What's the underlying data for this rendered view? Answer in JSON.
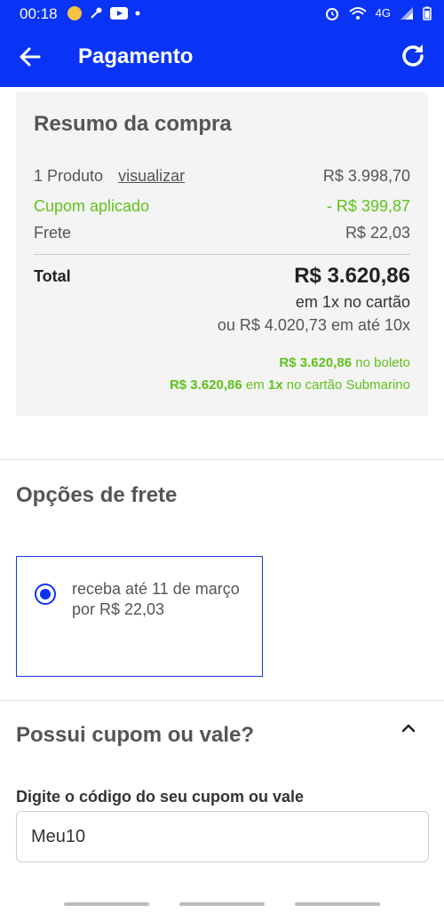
{
  "status": {
    "time": "00:18",
    "network": "4G"
  },
  "appbar": {
    "title": "Pagamento",
    "back_icon": "arrow-left-icon",
    "refresh_icon": "refresh-icon"
  },
  "summary": {
    "heading": "Resumo da compra",
    "product_label": "1 Produto",
    "view_link": "visualizar",
    "product_value": "R$ 3.998,70",
    "coupon_label": "Cupom aplicado",
    "coupon_value": "- R$ 399,87",
    "shipping_label": "Frete",
    "shipping_value": "R$ 22,03",
    "total_label": "Total",
    "total_value": "R$ 3.620,86",
    "total_line1": "em 1x no cartão",
    "total_line2": "ou R$ 4.020,73 em até 10x",
    "boleto_value": "R$ 3.620,86",
    "boleto_text": " no boleto",
    "card_value": "R$ 3.620,86",
    "card_mid": " em ",
    "card_times": "1x",
    "card_text": " no cartão Submarino"
  },
  "shipping": {
    "title": "Opções de frete",
    "option_text": "receba até 11 de março por R$ 22,03",
    "selected": true
  },
  "coupon": {
    "title": "Possui cupom ou vale?",
    "field_label": "Digite o código do seu cupom ou vale",
    "field_value": "Meu10"
  },
  "colors": {
    "brand": "#0a34f5",
    "green": "#5fc21b"
  }
}
